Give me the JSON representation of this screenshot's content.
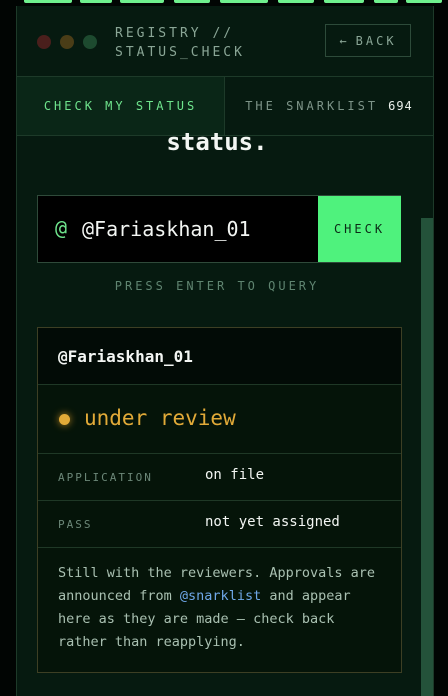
{
  "window": {
    "title_line1": "REGISTRY //",
    "title_line2": "STATUS_CHECK",
    "back_label": "BACK"
  },
  "tabs": [
    {
      "label": "CHECK MY STATUS",
      "active": true
    },
    {
      "label": "THE SNARKLIST",
      "count": "694",
      "active": false
    }
  ],
  "heading": "status.",
  "search": {
    "prefix": "@",
    "value": "@Fariaskhan_01",
    "button_label": "CHECK",
    "hint": "PRESS ENTER TO QUERY"
  },
  "result": {
    "username": "@Fariaskhan_01",
    "status": "under review",
    "rows": [
      {
        "label": "APPLICATION",
        "value": "on file"
      },
      {
        "label": "PASS",
        "value": "not yet assigned"
      }
    ],
    "note": {
      "before": "Still with the reviewers. Approvals are announced from ",
      "mention": "@snarklist",
      "after": " and appear here as they are made — check back rather than reapplying."
    }
  },
  "colors": {
    "accent_green": "#4ff27d",
    "status_amber": "#e2aa38",
    "mention_blue": "#6fa7e8"
  },
  "icons": {
    "back": "arrow-left-icon",
    "status": "status-dot-icon"
  }
}
